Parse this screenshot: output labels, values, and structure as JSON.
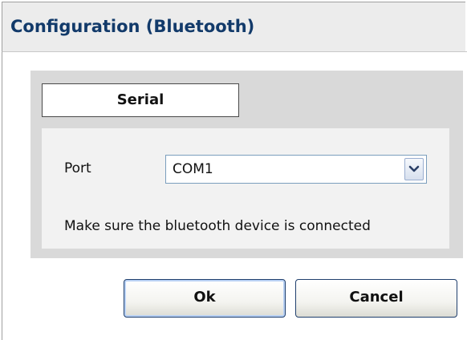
{
  "dialog": {
    "title": "Configuration (Bluetooth)"
  },
  "tabs": [
    {
      "label": "Serial",
      "selected": true
    }
  ],
  "form": {
    "port_label": "Port",
    "port_value": "COM1",
    "hint": "Make sure the bluetooth device is connected"
  },
  "buttons": {
    "ok_label": "Ok",
    "cancel_label": "Cancel"
  },
  "icons": {
    "dropdown": "chevron-down-icon"
  },
  "colors": {
    "title_text": "#123a6a",
    "panel_bg": "#d9d9d9",
    "content_bg": "#f2f2f2",
    "focus_ring": "#b9d1f4"
  }
}
